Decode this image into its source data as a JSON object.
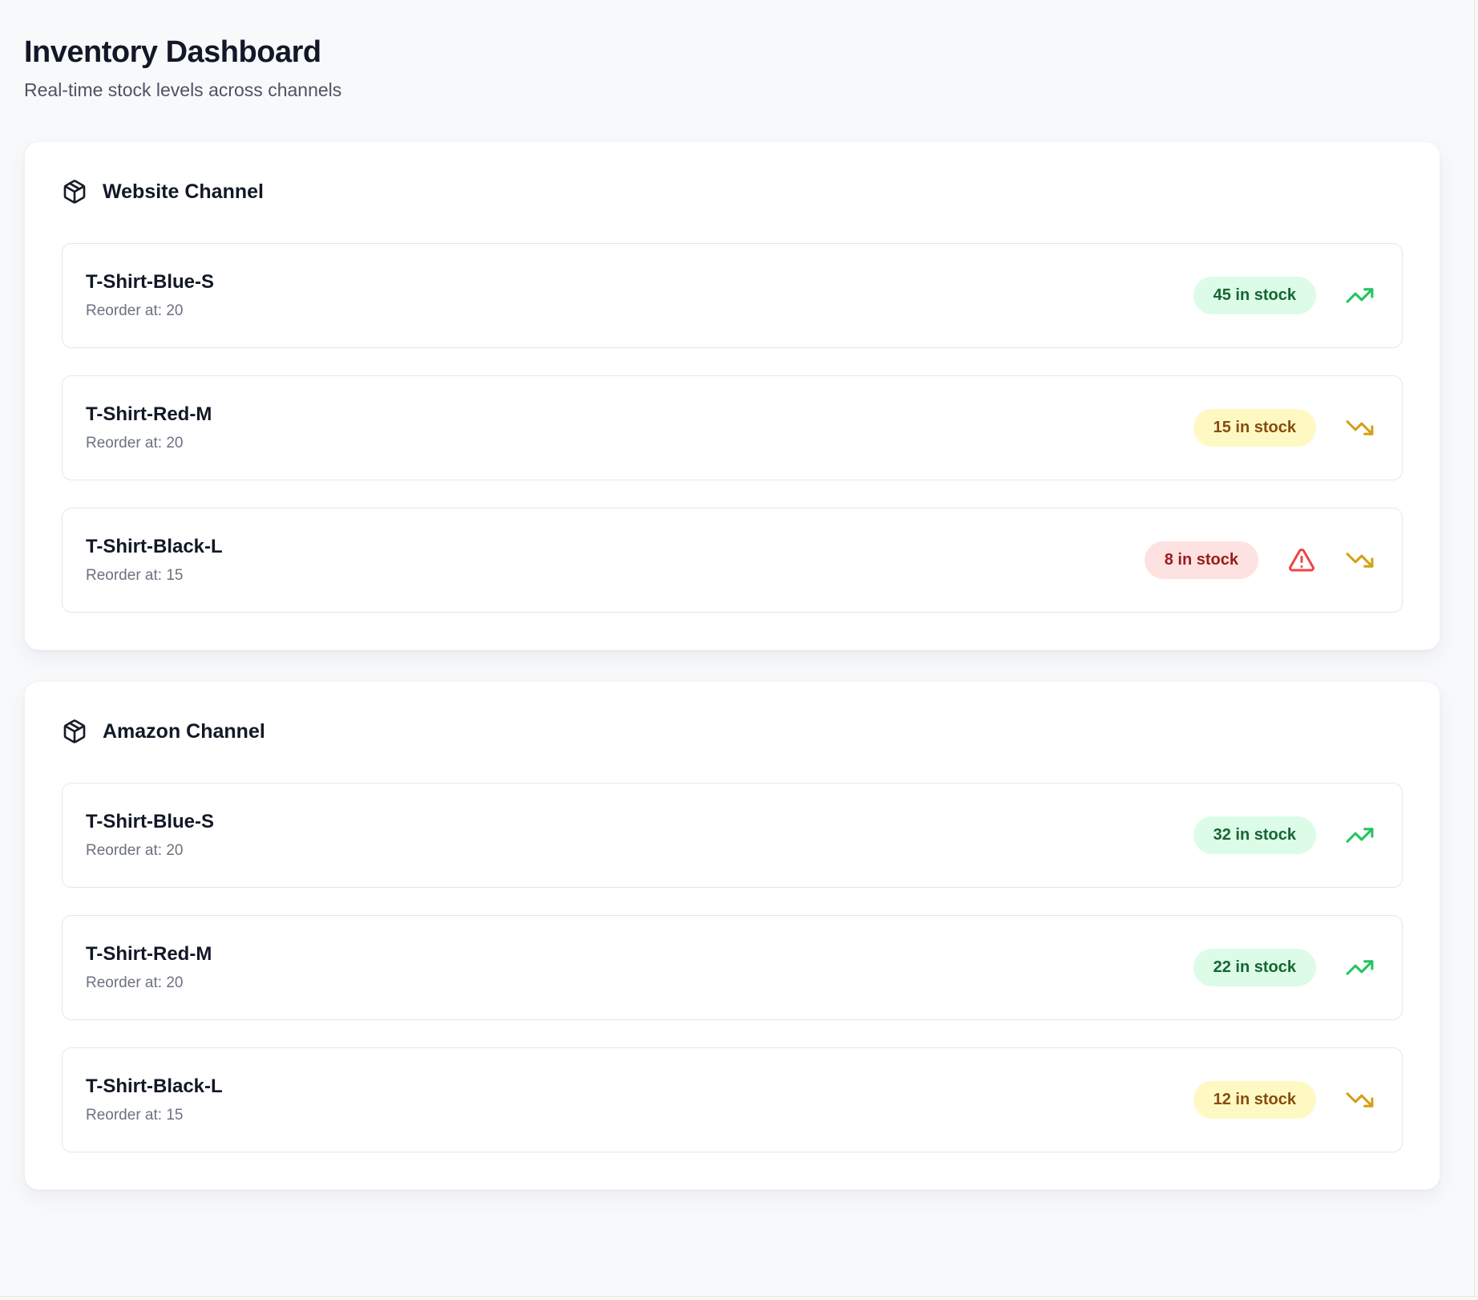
{
  "page": {
    "title": "Inventory Dashboard",
    "subtitle": "Real-time stock levels across channels"
  },
  "colors": {
    "page_bg": "#f8f9fb",
    "card_bg": "#ffffff",
    "row_border": "#e5e7eb",
    "heading_text": "#111827",
    "muted_text": "#6b7280",
    "badge_high_bg": "#dcfce7",
    "badge_high_text": "#166534",
    "badge_medium_bg": "#fef9c3",
    "badge_medium_text": "#854d0e",
    "badge_low_bg": "#fee2e2",
    "badge_low_text": "#991b1b",
    "trend_up": "#22c55e",
    "trend_down": "#d4a017",
    "alert": "#ef4444"
  },
  "channels": [
    {
      "name": "Website Channel",
      "icon": "package-icon",
      "products": [
        {
          "name": "T-Shirt-Blue-S",
          "reorder_text": "Reorder at: 20",
          "stock_text": "45 in stock",
          "stock_level": "high",
          "trend": "up",
          "alert": false
        },
        {
          "name": "T-Shirt-Red-M",
          "reorder_text": "Reorder at: 20",
          "stock_text": "15 in stock",
          "stock_level": "medium",
          "trend": "down",
          "alert": false
        },
        {
          "name": "T-Shirt-Black-L",
          "reorder_text": "Reorder at: 15",
          "stock_text": "8 in stock",
          "stock_level": "low",
          "trend": "down",
          "alert": true
        }
      ]
    },
    {
      "name": "Amazon Channel",
      "icon": "package-icon",
      "products": [
        {
          "name": "T-Shirt-Blue-S",
          "reorder_text": "Reorder at: 20",
          "stock_text": "32 in stock",
          "stock_level": "high",
          "trend": "up",
          "alert": false
        },
        {
          "name": "T-Shirt-Red-M",
          "reorder_text": "Reorder at: 20",
          "stock_text": "22 in stock",
          "stock_level": "high",
          "trend": "up",
          "alert": false
        },
        {
          "name": "T-Shirt-Black-L",
          "reorder_text": "Reorder at: 15",
          "stock_text": "12 in stock",
          "stock_level": "medium",
          "trend": "down",
          "alert": false
        }
      ]
    }
  ]
}
